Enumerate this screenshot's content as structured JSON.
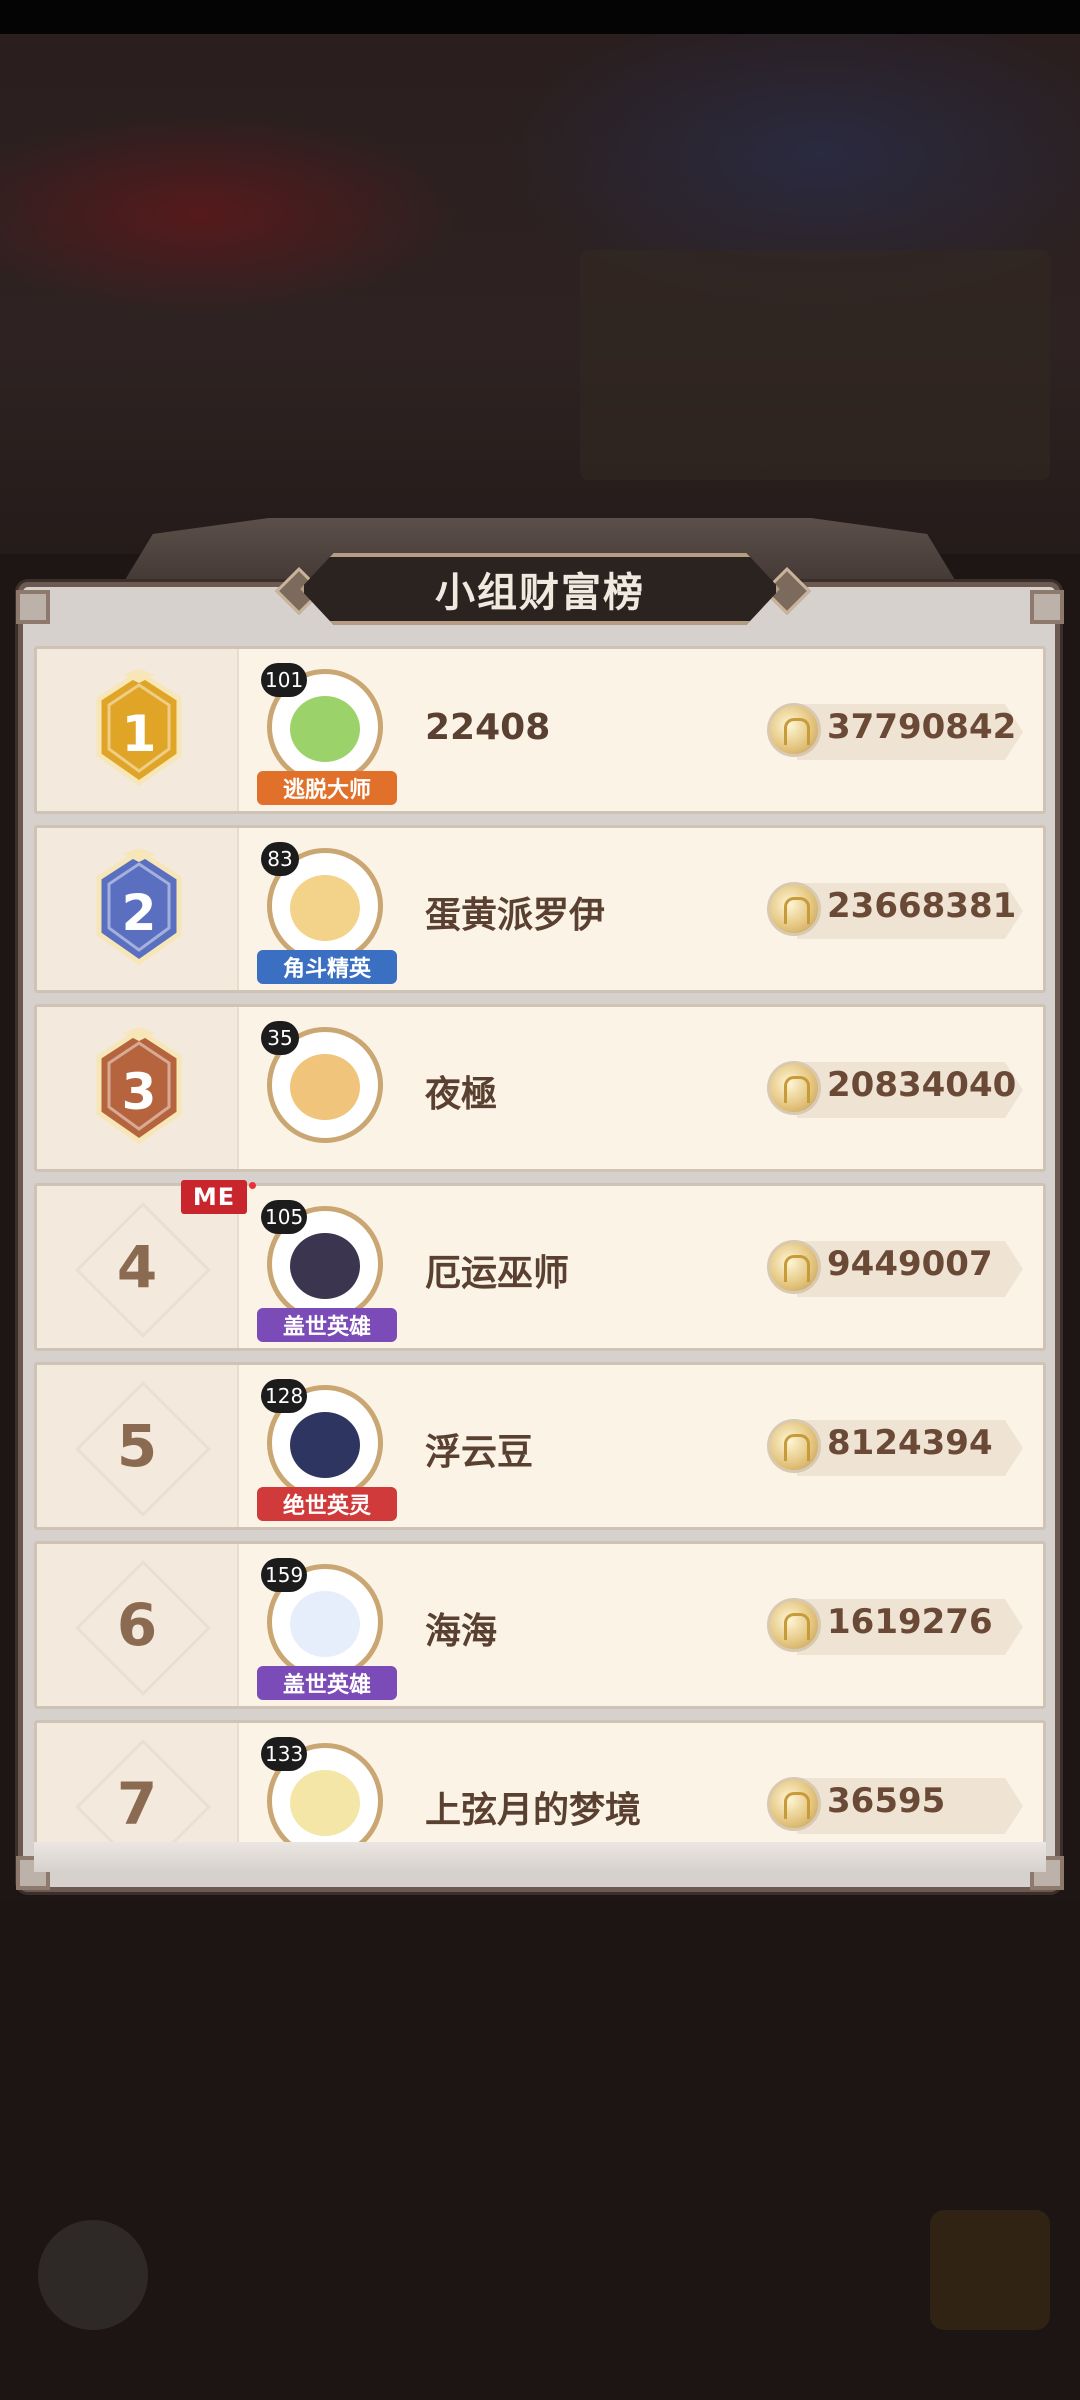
{
  "panel": {
    "title": "小组财富榜"
  },
  "me_badge": "ME",
  "leaderboard": [
    {
      "rank": "1",
      "name": "22408",
      "wealth": "37790842",
      "level": "101",
      "title": "逃脱大师",
      "medal": "gold"
    },
    {
      "rank": "2",
      "name": "蛋黄派罗伊",
      "wealth": "23668381",
      "level": "83",
      "title": "角斗精英",
      "medal": "silver"
    },
    {
      "rank": "3",
      "name": "夜極",
      "wealth": "20834040",
      "level": "35",
      "title": "",
      "medal": "bronze"
    },
    {
      "rank": "4",
      "name": "厄运巫师",
      "wealth": "9449007",
      "level": "105",
      "title": "盖世英雄",
      "medal": ""
    },
    {
      "rank": "5",
      "name": "浮云豆",
      "wealth": "8124394",
      "level": "128",
      "title": "绝世英灵",
      "medal": ""
    },
    {
      "rank": "6",
      "name": "海海",
      "wealth": "1619276",
      "level": "159",
      "title": "盖世英雄",
      "medal": ""
    },
    {
      "rank": "7",
      "name": "上弦月的梦境",
      "wealth": "36595",
      "level": "133",
      "title": "",
      "medal": ""
    }
  ],
  "colors": {
    "gold_medal": "#e0a526",
    "silver_medal": "#5b6fc0",
    "bronze_medal": "#b6643e",
    "title_orange": "#e0702a",
    "title_blue": "#3a6fc2",
    "title_purple": "#7b4bb8",
    "title_red": "#d03a3a"
  }
}
